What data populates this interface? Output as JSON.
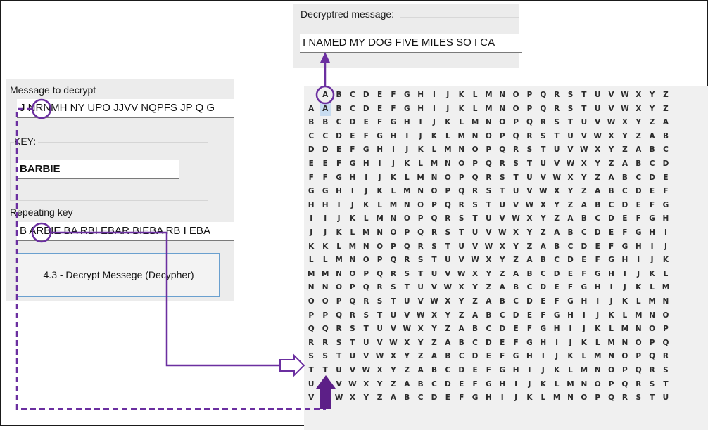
{
  "decrypted": {
    "label": "Decryptred message:",
    "value": "I NAMED MY DOG FIVE MILES SO I CA"
  },
  "message": {
    "label": "Message to decrypt",
    "value": "J NRNMH NY UPO JJVV NQPFS JP Q G"
  },
  "key": {
    "label": "KEY:",
    "value": "BARBIE"
  },
  "repeating": {
    "label": "Repeating key",
    "value": "B ARBIE BA RBI EBAR BIEBA RB I EBA"
  },
  "button": {
    "label": "4.3 -  Decrypt Messege (Decypher)"
  },
  "table": {
    "header": [
      "A",
      "B",
      "C",
      "D",
      "E",
      "F",
      "G",
      "H",
      "I",
      "J",
      "K",
      "L",
      "M",
      "N",
      "O",
      "P",
      "Q",
      "R",
      "S",
      "T",
      "U",
      "V",
      "W",
      "X",
      "Y",
      "Z"
    ],
    "row_labels": [
      "A",
      "B",
      "C",
      "D",
      "E",
      "F",
      "G",
      "H",
      "I",
      "J",
      "K",
      "L",
      "M",
      "N",
      "O",
      "P",
      "Q",
      "R",
      "S",
      "T",
      "U",
      "V"
    ]
  },
  "colors": {
    "accent": "#6b2fa0",
    "arrow_fill": "#5c1f87",
    "highlight": "#c8dcf0"
  }
}
